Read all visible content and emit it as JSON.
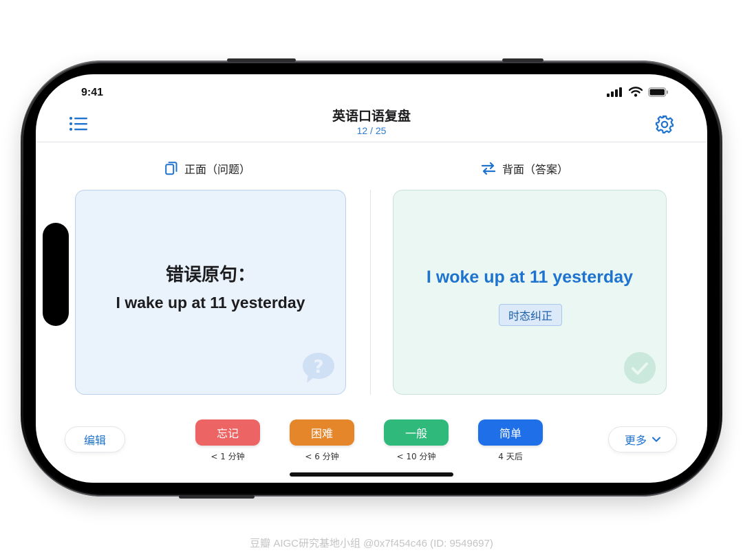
{
  "status_bar": {
    "time": "9:41"
  },
  "header": {
    "title": "英语口语复盘",
    "progress": "12 / 25"
  },
  "front_side": {
    "label": "正面（问题）",
    "heading": "错误原句：",
    "sentence": "I wake up at 11 yesterday"
  },
  "back_side": {
    "label": "背面（答案）",
    "sentence": "I woke up at 11 yesterday",
    "tag": "时态纠正"
  },
  "actions": {
    "edit_label": "编辑",
    "more_label": "更多",
    "grades": [
      {
        "label": "忘记",
        "interval": "< 1 分钟",
        "color": "#ec6464"
      },
      {
        "label": "困难",
        "interval": "< 6 分钟",
        "color": "#e5862a"
      },
      {
        "label": "一般",
        "interval": "< 10 分钟",
        "color": "#2fb97a"
      },
      {
        "label": "简单",
        "interval": "4 天后",
        "color": "#1f6fe8"
      }
    ]
  },
  "colors": {
    "accent": "#1e73cf",
    "front_card_bg": "#eaf2fc",
    "back_card_bg": "#eaf7f2"
  },
  "watermark": "豆瓣 AIGC研究基地小组 @0x7f454c46 (ID: 9549697)"
}
